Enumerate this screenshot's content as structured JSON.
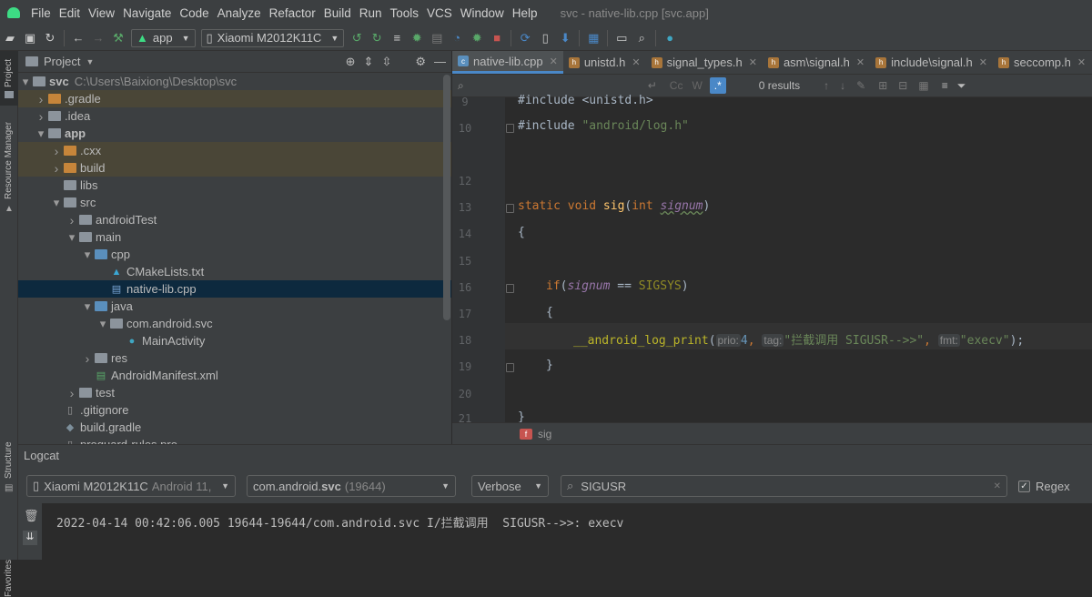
{
  "menu": {
    "items": [
      "File",
      "Edit",
      "View",
      "Navigate",
      "Code",
      "Analyze",
      "Refactor",
      "Build",
      "Run",
      "Tools",
      "VCS",
      "Window",
      "Help"
    ],
    "window_title": "svc - native-lib.cpp [svc.app]"
  },
  "toolbar": {
    "run_config": "app",
    "device": "Xiaomi M2012K11C"
  },
  "leftstrip": {
    "project": "Project",
    "resource_manager": "Resource Manager",
    "structure": "Structure",
    "favorites": "Favorites"
  },
  "project": {
    "title": "Project",
    "tree": [
      {
        "label": "svc",
        "extra": "C:\\Users\\Baixiong\\Desktop\\svc",
        "indent": 0,
        "arrow": "down",
        "icon": "gray",
        "bold": true
      },
      {
        "label": ".gradle",
        "indent": 1,
        "arrow": "right",
        "icon": "orange",
        "highlight": true
      },
      {
        "label": ".idea",
        "indent": 1,
        "arrow": "right",
        "icon": "gray"
      },
      {
        "label": "app",
        "indent": 1,
        "arrow": "down",
        "icon": "gray",
        "bold": true
      },
      {
        "label": ".cxx",
        "indent": 2,
        "arrow": "right",
        "icon": "orange",
        "highlight": true
      },
      {
        "label": "build",
        "indent": 2,
        "arrow": "right",
        "icon": "orange",
        "highlight": true
      },
      {
        "label": "libs",
        "indent": 2,
        "arrow": "",
        "icon": "gray"
      },
      {
        "label": "src",
        "indent": 2,
        "arrow": "down",
        "icon": "gray"
      },
      {
        "label": "androidTest",
        "indent": 3,
        "arrow": "right",
        "icon": "gray"
      },
      {
        "label": "main",
        "indent": 3,
        "arrow": "down",
        "icon": "gray"
      },
      {
        "label": "cpp",
        "indent": 4,
        "arrow": "down",
        "icon": "blue"
      },
      {
        "label": "CMakeLists.txt",
        "indent": 5,
        "arrow": "",
        "icon": "cmake"
      },
      {
        "label": "native-lib.cpp",
        "indent": 5,
        "arrow": "",
        "icon": "cpp",
        "selected": true
      },
      {
        "label": "java",
        "indent": 4,
        "arrow": "down",
        "icon": "blue"
      },
      {
        "label": "com.android.svc",
        "indent": 5,
        "arrow": "down",
        "icon": "gray"
      },
      {
        "label": "MainActivity",
        "indent": 6,
        "arrow": "",
        "icon": "class"
      },
      {
        "label": "res",
        "indent": 4,
        "arrow": "right",
        "icon": "gray"
      },
      {
        "label": "AndroidManifest.xml",
        "indent": 4,
        "arrow": "",
        "icon": "xml"
      },
      {
        "label": "test",
        "indent": 3,
        "arrow": "right",
        "icon": "gray"
      },
      {
        "label": ".gitignore",
        "indent": 2,
        "arrow": "",
        "icon": "file"
      },
      {
        "label": "build.gradle",
        "indent": 2,
        "arrow": "",
        "icon": "gradle"
      },
      {
        "label": "proguard-rules.pro",
        "indent": 2,
        "arrow": "",
        "icon": "file"
      }
    ]
  },
  "editor": {
    "tabs": [
      {
        "label": "native-lib.cpp",
        "active": true,
        "type": "cpp"
      },
      {
        "label": "unistd.h",
        "type": "h"
      },
      {
        "label": "signal_types.h",
        "type": "h"
      },
      {
        "label": "asm\\signal.h",
        "type": "h"
      },
      {
        "label": "include\\signal.h",
        "type": "h"
      },
      {
        "label": "seccomp.h",
        "type": "h"
      }
    ],
    "find": {
      "results": "0 results",
      "cc": "Cc",
      "w": "W"
    },
    "line_numbers": [
      "9",
      "10",
      "12",
      "13",
      "14",
      "15",
      "16",
      "17",
      "18",
      "19",
      "20",
      "21"
    ],
    "lines": {
      "l9": "#include <unistd.h>",
      "l10_a": "#include ",
      "l10_b": "\"android/log.h\"",
      "l13_kw": "static void ",
      "l13_fn": "sig",
      "l13_p": "(",
      "l13_int": "int ",
      "l13_param": "signum",
      "l13_close": ")",
      "l14": "{",
      "l16_if": "if",
      "l16_open": "(",
      "l16_param": "signum",
      "l16_eq": " == ",
      "l16_mac": "SIGSYS",
      "l16_close": ")",
      "l17": "{",
      "l18_call": "__android_log_print",
      "l18_open": "(",
      "l18_h1": "prio:",
      "l18_num": "4",
      "l18_c1": ", ",
      "l18_h2": "tag:",
      "l18_s1": "\"拦截调用 SIGUSR-->>\"",
      "l18_c2": ", ",
      "l18_h3": "fmt:",
      "l18_s2": "\"execv\"",
      "l18_close": ");",
      "l19": "}",
      "l21": "}"
    },
    "breadcrumb": "sig"
  },
  "logcat": {
    "title": "Logcat",
    "device": "Xiaomi M2012K11C",
    "device_extra": "Android 11,",
    "process": "com.android.",
    "process_bold": "svc",
    "process_pid": "(19644)",
    "level": "Verbose",
    "search": "SIGUSR",
    "regex": "Regex",
    "log_line": "2022-04-14 00:42:06.005 19644-19644/com.android.svc I/拦截调用  SIGUSR-->>: execv"
  },
  "colors": {
    "accent": "#4a88c7",
    "android_green": "#3ddc84",
    "keyword": "#cc7832",
    "string": "#6a8759",
    "function": "#ffc66d"
  }
}
